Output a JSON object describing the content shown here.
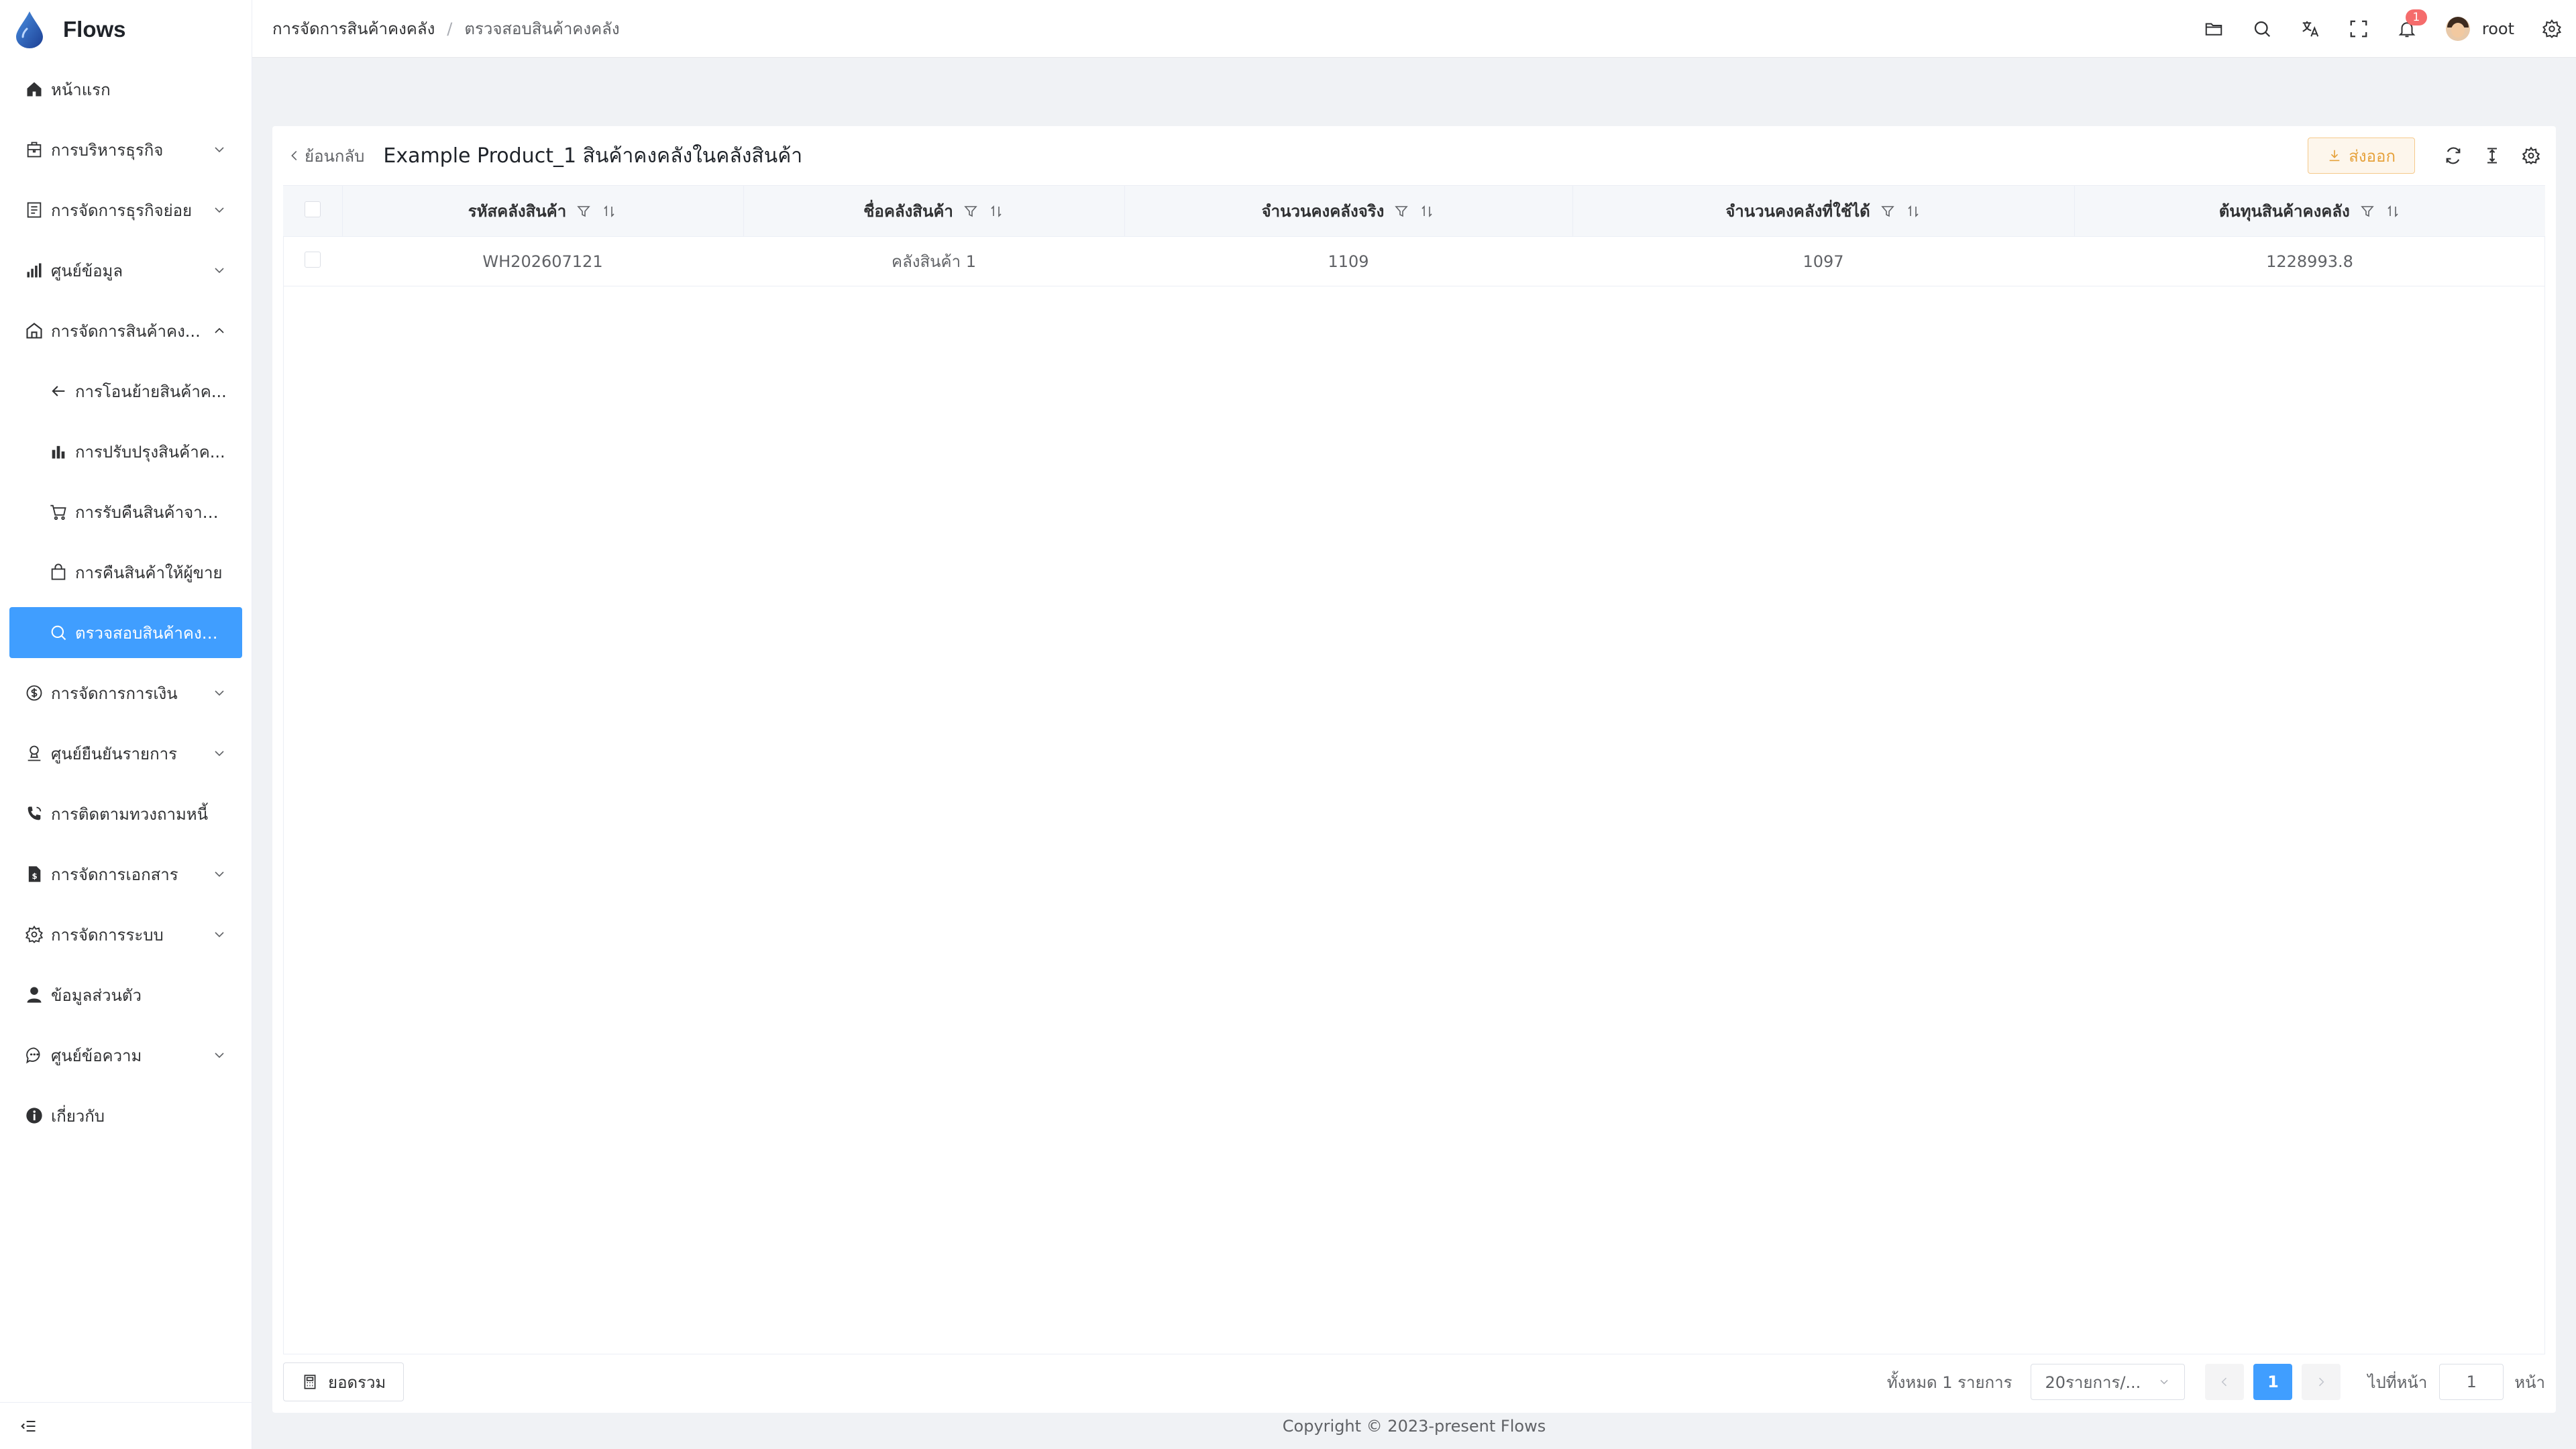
{
  "app": {
    "name": "Flows"
  },
  "sidebar": {
    "items": [
      {
        "label": "หน้าแรก",
        "icon": "home-icon",
        "chevron": false
      },
      {
        "label": "การบริหารธุรกิจ",
        "icon": "building-icon",
        "chevron": true
      },
      {
        "label": "การจัดการธุรกิจย่อย",
        "icon": "document-list-icon",
        "chevron": true
      },
      {
        "label": "ศูนย์ข้อมูล",
        "icon": "bar-chart-icon",
        "chevron": true
      },
      {
        "label": "การจัดการสินค้าคง...",
        "icon": "warehouse-icon",
        "chevron": true,
        "expanded": true
      },
      {
        "label": "การโอนย้ายสินค้าค...",
        "icon": "arrow-left-icon",
        "sub": true
      },
      {
        "label": "การปรับปรุงสินค้าค...",
        "icon": "bar-chart-icon",
        "sub": true
      },
      {
        "label": "การรับคืนสินค้าจาก...",
        "icon": "cart-icon",
        "sub": true
      },
      {
        "label": "การคืนสินค้าให้ผู้ขาย",
        "icon": "bag-icon",
        "sub": true
      },
      {
        "label": "ตรวจสอบสินค้าคงคลัง",
        "icon": "search-icon",
        "sub": true,
        "active": true
      },
      {
        "label": "การจัดการการเงิน",
        "icon": "dollar-icon",
        "chevron": true
      },
      {
        "label": "ศูนย์ยืนยันรายการ",
        "icon": "stamp-icon",
        "chevron": true
      },
      {
        "label": "การติดตามทวงถามหนี้",
        "icon": "phone-icon",
        "chevron": false
      },
      {
        "label": "การจัดการเอกสาร",
        "icon": "file-dollar-icon",
        "chevron": true
      },
      {
        "label": "การจัดการระบบ",
        "icon": "gear-icon",
        "chevron": true
      },
      {
        "label": "ข้อมูลส่วนตัว",
        "icon": "user-icon",
        "chevron": false
      },
      {
        "label": "ศูนย์ข้อความ",
        "icon": "chat-icon",
        "chevron": true
      },
      {
        "label": "เกี่ยวกับ",
        "icon": "info-icon",
        "chevron": false
      }
    ]
  },
  "header": {
    "breadcrumb": [
      "การจัดการสินค้าคงคลัง",
      "ตรวจสอบสินค้าคงคลัง"
    ],
    "separator": "/",
    "notification_count": "1",
    "username": "root"
  },
  "card": {
    "back_label": "ย้อนกลับ",
    "title": "Example Product_1 สินค้าคงคลังในคลังสินค้า",
    "export_label": "ส่งออก"
  },
  "table": {
    "columns": [
      "รหัสคลังสินค้า",
      "ชื่อคลังสินค้า",
      "จำนวนคงคลังจริง",
      "จำนวนคงคลังที่ใช้ได้",
      "ต้นทุนสินค้าคงคลัง"
    ],
    "rows": [
      [
        "WH202607121",
        "คลังสินค้า 1",
        "1109",
        "1097",
        "1228993.8"
      ]
    ]
  },
  "footer": {
    "summary_label": "ยอดรวม",
    "total_text": "ทั้งหมด 1 รายการ",
    "page_size": "20รายการ/...",
    "current_page": "1",
    "goto_label": "ไปที่หน้า",
    "goto_value": "1",
    "goto_unit": "หน้า"
  },
  "copyright": "Copyright © 2023-present Flows",
  "colors": {
    "primary": "#409eff",
    "warning": "#e6a23c",
    "danger": "#f56c6c"
  }
}
